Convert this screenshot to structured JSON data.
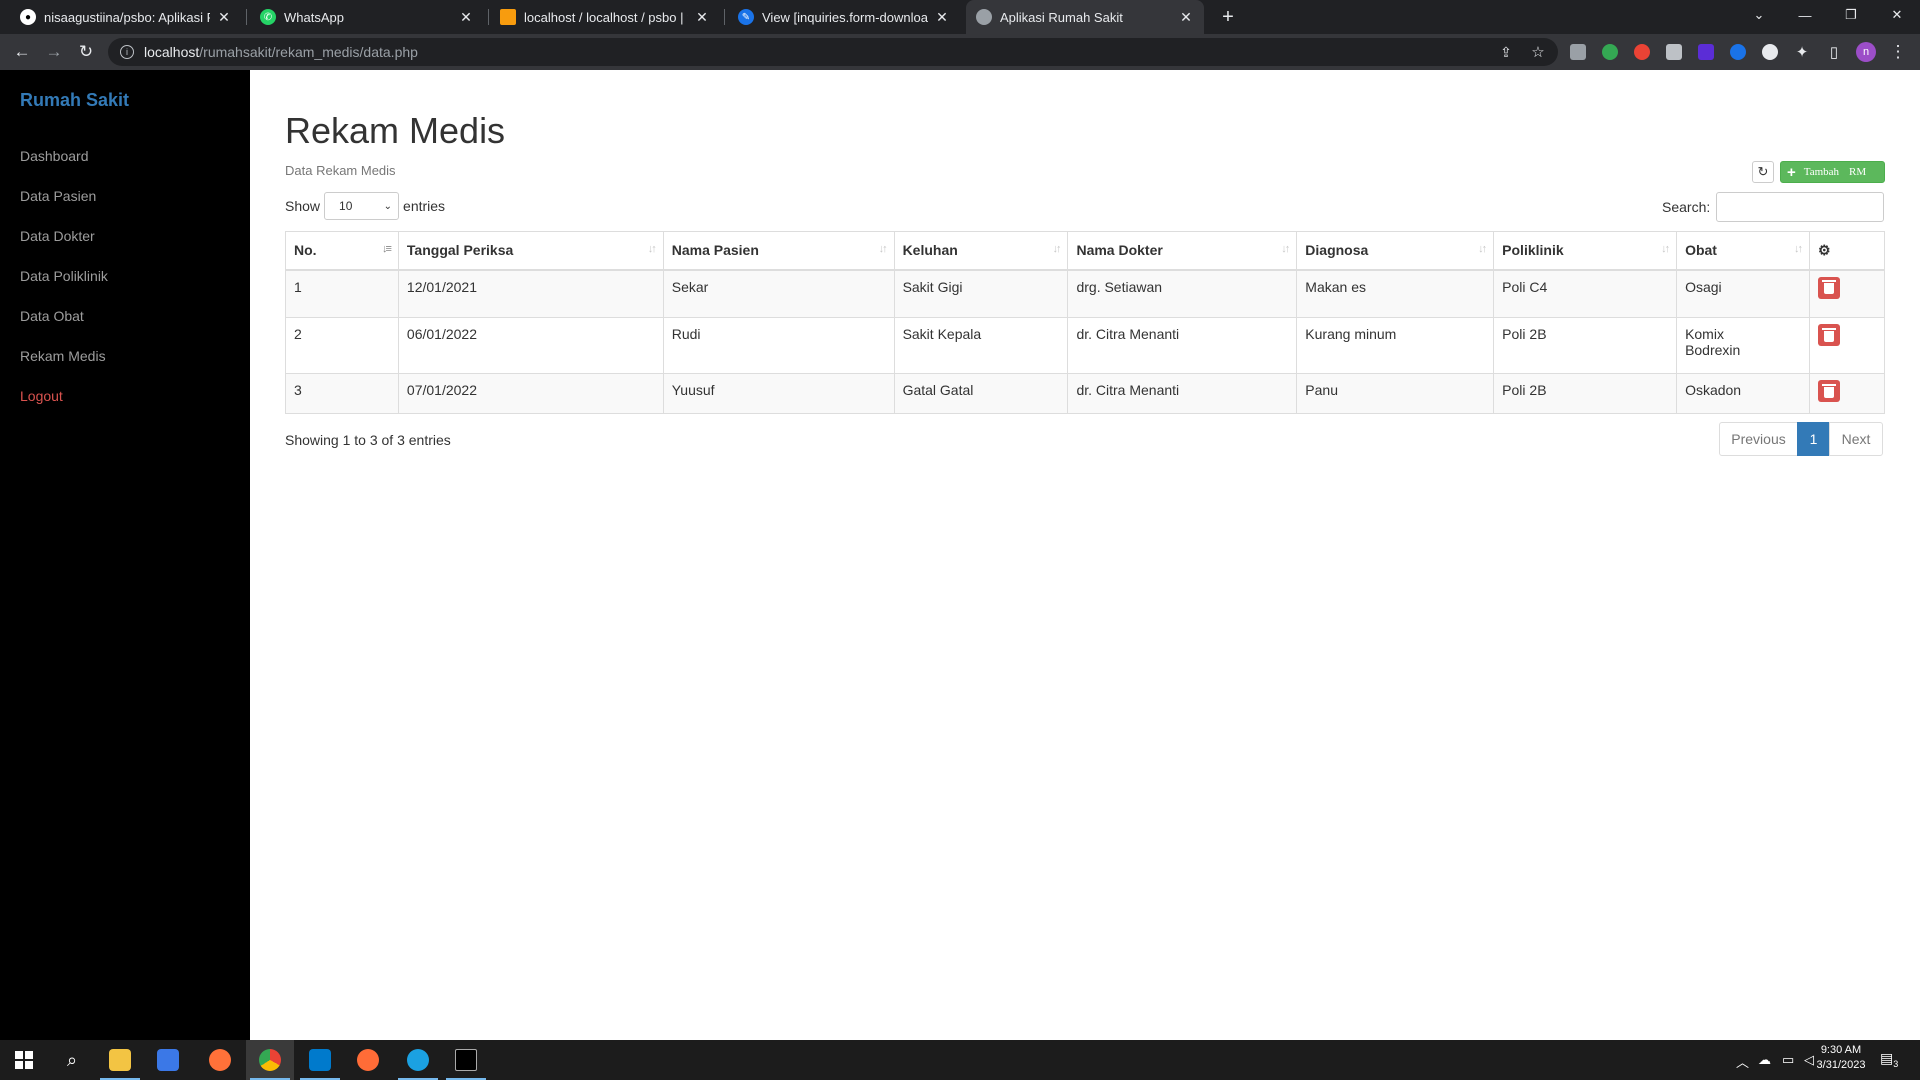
{
  "browser": {
    "tabs": [
      {
        "title": "nisaagustiina/psbo: Aplikasi PPDB",
        "active": false,
        "icon": "github-icon"
      },
      {
        "title": "WhatsApp",
        "active": false,
        "icon": "whatsapp-icon"
      },
      {
        "title": "localhost / localhost / psbo | phpMyAdmin",
        "active": false,
        "icon": "phpmyadmin-icon"
      },
      {
        "title": "View [inquiries.form-download]",
        "active": false,
        "icon": "edit-icon"
      },
      {
        "title": "Aplikasi Rumah Sakit",
        "active": true,
        "icon": "globe-icon"
      }
    ],
    "url_host": "localhost",
    "url_path": "/rumahsakit/rekam_medis/data.php",
    "profile_initial": "n"
  },
  "sidebar": {
    "brand": "Rumah Sakit",
    "items": [
      {
        "label": "Dashboard"
      },
      {
        "label": "Data Pasien"
      },
      {
        "label": "Data Dokter"
      },
      {
        "label": "Data Poliklinik"
      },
      {
        "label": "Data Obat"
      },
      {
        "label": "Rekam Medis"
      }
    ],
    "logout": "Logout"
  },
  "main": {
    "title": "Rekam Medis",
    "subtitle": "Data Rekam Medis",
    "add_button": {
      "word1": "Tambah",
      "word2": "RM"
    },
    "length": {
      "prefix": "Show",
      "value": "10",
      "suffix": "entries"
    },
    "search_label": "Search:",
    "columns": [
      "No.",
      "Tanggal Periksa",
      "Nama Pasien",
      "Keluhan",
      "Nama Dokter",
      "Diagnosa",
      "Poliklinik",
      "Obat"
    ],
    "rows": [
      {
        "no": "1",
        "tanggal": "12/01/2021",
        "pasien": "Sekar",
        "keluhan": "Sakit Gigi",
        "dokter": "drg. Setiawan",
        "diagnosa": "Makan es",
        "poli": "Poli C4",
        "obat": [
          "Osagi"
        ]
      },
      {
        "no": "2",
        "tanggal": "06/01/2022",
        "pasien": "Rudi",
        "keluhan": "Sakit Kepala",
        "dokter": "dr. Citra Menanti",
        "diagnosa": "Kurang minum",
        "poli": "Poli 2B",
        "obat": [
          "Komix",
          "Bodrexin"
        ]
      },
      {
        "no": "3",
        "tanggal": "07/01/2022",
        "pasien": "Yuusuf",
        "keluhan": "Gatal Gatal",
        "dokter": "dr. Citra Menanti",
        "diagnosa": "Panu",
        "poli": "Poli 2B",
        "obat": [
          "Oskadon"
        ]
      }
    ],
    "info": "Showing 1 to 3 of 3 entries",
    "pager": {
      "prev": "Previous",
      "current": "1",
      "next": "Next"
    }
  },
  "taskbar": {
    "time": "9:30 AM",
    "date": "3/31/2023",
    "notifications": "3"
  },
  "colors": {
    "brand": "#337ab7",
    "logout": "#d9534f",
    "add": "#5cb85c",
    "delete": "#d9534f"
  }
}
